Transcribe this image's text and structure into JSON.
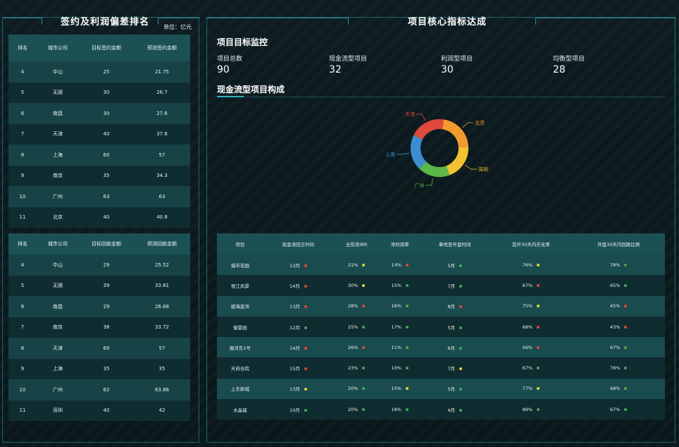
{
  "left": {
    "title": "签约及利润偏差排名",
    "unit": "单位：亿元",
    "table1": {
      "headers": [
        "排名",
        "城市公司",
        "目标签约金额",
        "预测签约金额"
      ],
      "rows": [
        [
          "4",
          "中山",
          "25",
          "21.75"
        ],
        [
          "5",
          "无锡",
          "30",
          "26.7"
        ],
        [
          "6",
          "南昌",
          "30",
          "27.6"
        ],
        [
          "7",
          "天津",
          "40",
          "37.6"
        ],
        [
          "8",
          "上海",
          "60",
          "57"
        ],
        [
          "9",
          "南京",
          "35",
          "34.3"
        ],
        [
          "10",
          "广州",
          "63",
          "63"
        ],
        [
          "11",
          "北京",
          "40",
          "40.8"
        ]
      ]
    },
    "table2": {
      "headers": [
        "排名",
        "城市公司",
        "目标回款金额",
        "预测回款金额"
      ],
      "rows": [
        [
          "4",
          "中山",
          "29",
          "25.52"
        ],
        [
          "5",
          "无锡",
          "39",
          "33.81"
        ],
        [
          "6",
          "南昌",
          "29",
          "26.68"
        ],
        [
          "7",
          "南京",
          "38",
          "33.72"
        ],
        [
          "8",
          "天津",
          "60",
          "57"
        ],
        [
          "9",
          "上海",
          "35",
          "35"
        ],
        [
          "10",
          "广州",
          "62",
          "63.86"
        ],
        [
          "11",
          "深圳",
          "40",
          "42"
        ]
      ]
    }
  },
  "right": {
    "title": "项目核心指标达成",
    "monitor_title": "项目目标监控",
    "kpis": [
      {
        "label": "项目总数",
        "value": "90"
      },
      {
        "label": "现金流型项目",
        "value": "32"
      },
      {
        "label": "利润型项目",
        "value": "30"
      },
      {
        "label": "均衡型项目",
        "value": "28"
      }
    ],
    "composition_title": "现金流型项目构成",
    "chart_data": {
      "type": "pie",
      "categories": [
        "北京",
        "深圳",
        "广州",
        "上海",
        "天津"
      ],
      "values": [
        22,
        20,
        18,
        20,
        20
      ],
      "colors": [
        "#f39a2e",
        "#f2c230",
        "#5cb64a",
        "#3b8fd1",
        "#e04a3c"
      ]
    },
    "table": {
      "headers": [
        "项目",
        "现金流回正时间",
        "全投资IRR",
        "净利润率",
        "拿地至开盘时间",
        "首开30天内去化率",
        "开盘30天内回款比例"
      ],
      "rows": [
        [
          "城市花园",
          "13月",
          "21%",
          "14%",
          "5月",
          "76%",
          "78%"
        ],
        [
          "悦江风景",
          "14月",
          "30%",
          "15%",
          "7月",
          "67%",
          "65%"
        ],
        [
          "碧海蓝湾",
          "13月",
          "28%",
          "16%",
          "8月",
          "75%",
          "45%"
        ],
        [
          "御景园",
          "12月",
          "25%",
          "17%",
          "5月",
          "68%",
          "43%"
        ],
        [
          "御河东1号",
          "14月",
          "26%",
          "11%",
          "6月",
          "56%",
          "67%"
        ],
        [
          "天府合院",
          "15月",
          "23%",
          "10%",
          "7月",
          "67%",
          "76%"
        ],
        [
          "上东新城",
          "13月",
          "20%",
          "15%",
          "5月",
          "77%",
          "68%"
        ],
        [
          "水晶城",
          "10月",
          "20%",
          "18%",
          "4月",
          "89%",
          "67%"
        ]
      ],
      "dots": [
        [
          "red",
          "yellow",
          "red",
          "green",
          "yellow",
          "green"
        ],
        [
          "red",
          "yellow",
          "green",
          "green",
          "red",
          "green"
        ],
        [
          "red",
          "red",
          "green",
          "red",
          "yellow",
          "red"
        ],
        [
          "green",
          "green",
          "green",
          "green",
          "red",
          "red"
        ],
        [
          "red",
          "red",
          "green",
          "green",
          "red",
          "green"
        ],
        [
          "red",
          "green",
          "green",
          "yellow",
          "green",
          "green"
        ],
        [
          "yellow",
          "green",
          "yellow",
          "green",
          "yellow",
          "green"
        ],
        [
          "green",
          "green",
          "green",
          "green",
          "green",
          "green"
        ]
      ],
      "dot_colors": {
        "red": "#e0463b",
        "yellow": "#e8d43a",
        "green": "#45a85a"
      }
    }
  }
}
